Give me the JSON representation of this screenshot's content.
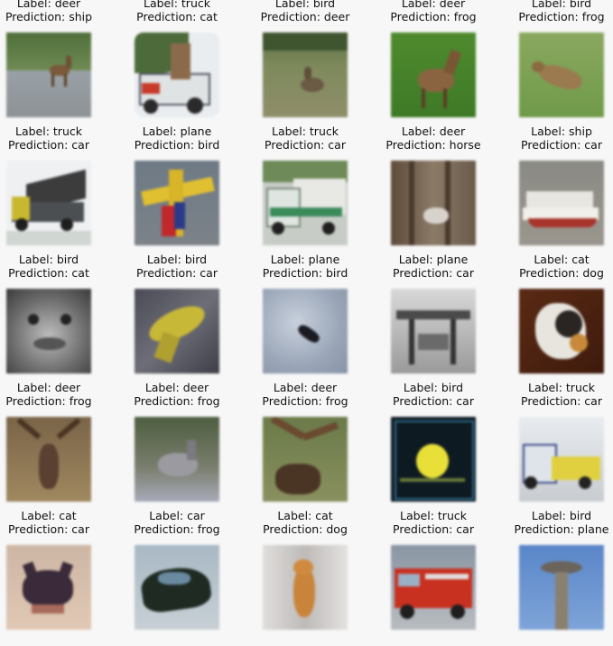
{
  "grid": [
    [
      {
        "label": "Label: deer",
        "prediction": "Prediction: ship"
      },
      {
        "label": "Label: truck",
        "prediction": "Prediction: cat"
      },
      {
        "label": "Label: bird",
        "prediction": "Prediction: deer"
      },
      {
        "label": "Label: deer",
        "prediction": "Prediction: frog"
      },
      {
        "label": "Label: bird",
        "prediction": "Prediction: frog"
      }
    ],
    [
      {
        "label": "Label: truck",
        "prediction": "Prediction: car"
      },
      {
        "label": "Label: plane",
        "prediction": "Prediction: bird"
      },
      {
        "label": "Label: truck",
        "prediction": "Prediction: car"
      },
      {
        "label": "Label: deer",
        "prediction": "Prediction: horse"
      },
      {
        "label": "Label: ship",
        "prediction": "Prediction: car"
      }
    ],
    [
      {
        "label": "Label: bird",
        "prediction": "Prediction: cat"
      },
      {
        "label": "Label: bird",
        "prediction": "Prediction: car"
      },
      {
        "label": "Label: plane",
        "prediction": "Prediction: bird"
      },
      {
        "label": "Label: plane",
        "prediction": "Prediction: car"
      },
      {
        "label": "Label: cat",
        "prediction": "Prediction: dog"
      }
    ],
    [
      {
        "label": "Label: deer",
        "prediction": "Prediction: frog"
      },
      {
        "label": "Label: deer",
        "prediction": "Prediction: frog"
      },
      {
        "label": "Label: deer",
        "prediction": "Prediction: frog"
      },
      {
        "label": "Label: bird",
        "prediction": "Prediction: car"
      },
      {
        "label": "Label: truck",
        "prediction": "Prediction: car"
      }
    ],
    [
      {
        "label": "Label: cat",
        "prediction": "Prediction: car"
      },
      {
        "label": "Label: car",
        "prediction": "Prediction: frog"
      },
      {
        "label": "Label: cat",
        "prediction": "Prediction: dog"
      },
      {
        "label": "Label: truck",
        "prediction": "Prediction: car"
      },
      {
        "label": "Label: bird",
        "prediction": "Prediction: plane"
      }
    ]
  ]
}
